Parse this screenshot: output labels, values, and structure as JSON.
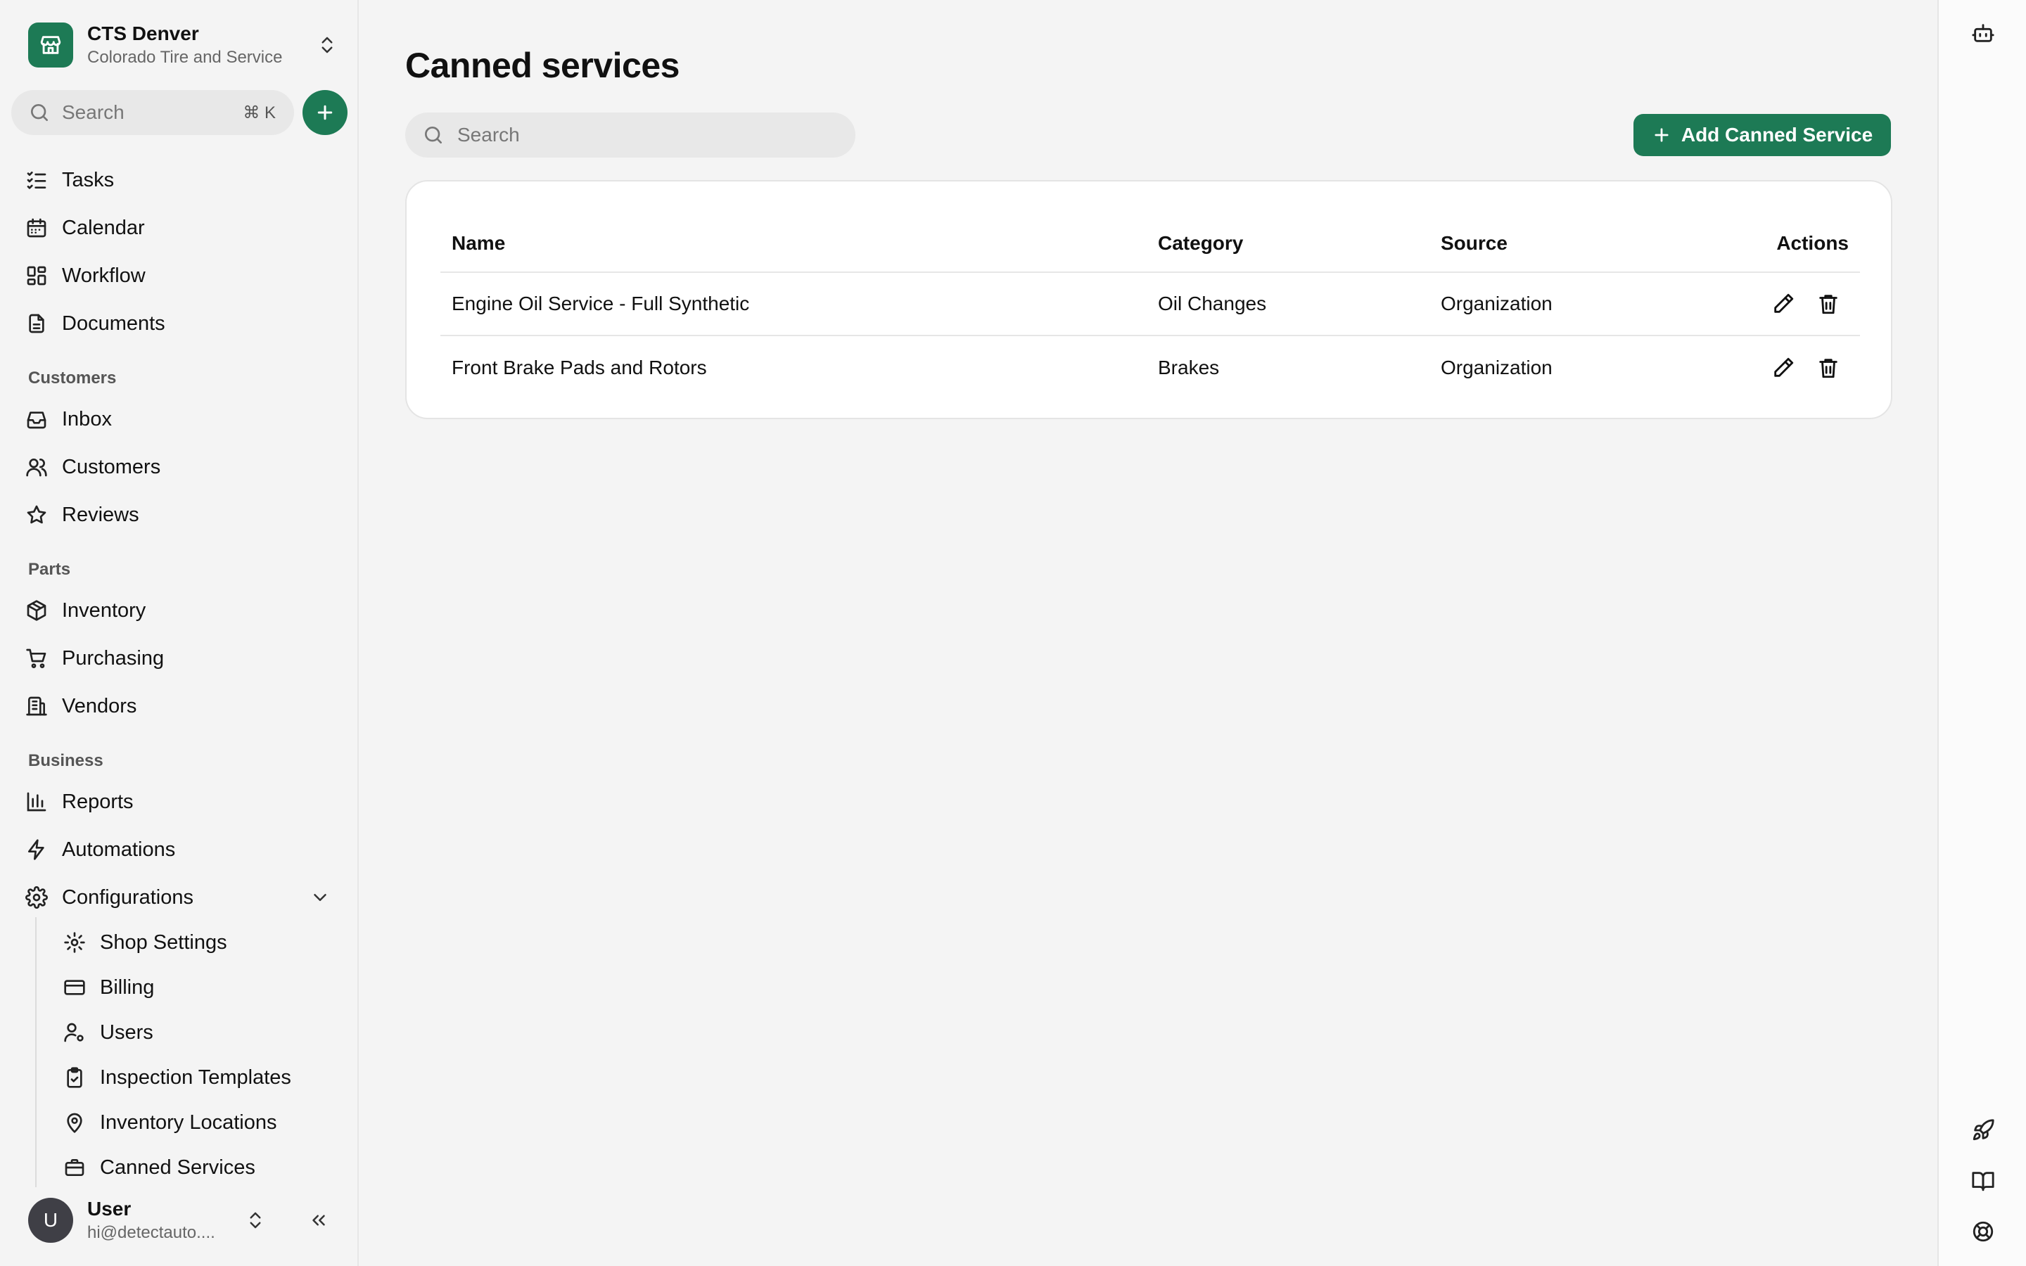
{
  "org": {
    "name": "CTS Denver",
    "subtitle": "Colorado Tire and Service"
  },
  "sidebar": {
    "search_placeholder": "Search",
    "search_shortcut": "⌘ K",
    "top_items": [
      {
        "label": "Tasks",
        "icon": "tasks-icon"
      },
      {
        "label": "Calendar",
        "icon": "calendar-icon"
      },
      {
        "label": "Workflow",
        "icon": "workflow-icon"
      },
      {
        "label": "Documents",
        "icon": "documents-icon"
      }
    ],
    "sections": [
      {
        "title": "Customers",
        "items": [
          {
            "label": "Inbox",
            "icon": "inbox-icon"
          },
          {
            "label": "Customers",
            "icon": "users-icon"
          },
          {
            "label": "Reviews",
            "icon": "star-icon"
          }
        ]
      },
      {
        "title": "Parts",
        "items": [
          {
            "label": "Inventory",
            "icon": "box-icon"
          },
          {
            "label": "Purchasing",
            "icon": "cart-icon"
          },
          {
            "label": "Vendors",
            "icon": "building-icon"
          }
        ]
      },
      {
        "title": "Business",
        "items": [
          {
            "label": "Reports",
            "icon": "bar-chart-icon"
          },
          {
            "label": "Automations",
            "icon": "lightning-icon"
          },
          {
            "label": "Configurations",
            "icon": "gear-icon"
          }
        ]
      }
    ],
    "config_items": [
      {
        "label": "Shop Settings",
        "icon": "gear-icon"
      },
      {
        "label": "Billing",
        "icon": "credit-card-icon"
      },
      {
        "label": "Users",
        "icon": "user-cog-icon"
      },
      {
        "label": "Inspection Templates",
        "icon": "clipboard-check-icon"
      },
      {
        "label": "Inventory Locations",
        "icon": "map-pin-icon"
      },
      {
        "label": "Canned Services",
        "icon": "briefcase-icon"
      }
    ]
  },
  "user": {
    "initial": "U",
    "name": "User",
    "email": "hi@detectauto...."
  },
  "main": {
    "title": "Canned services",
    "search_placeholder": "Search",
    "add_button": "Add Canned Service",
    "table": {
      "headers": {
        "name": "Name",
        "category": "Category",
        "source": "Source",
        "actions": "Actions"
      },
      "rows": [
        {
          "name": "Engine Oil Service - Full Synthetic",
          "category": "Oil Changes",
          "source": "Organization"
        },
        {
          "name": "Front Brake Pads and Rotors",
          "category": "Brakes",
          "source": "Organization"
        }
      ]
    }
  },
  "colors": {
    "accent": "#1d7a55",
    "background": "#f4f4f4",
    "card": "#ffffff"
  }
}
